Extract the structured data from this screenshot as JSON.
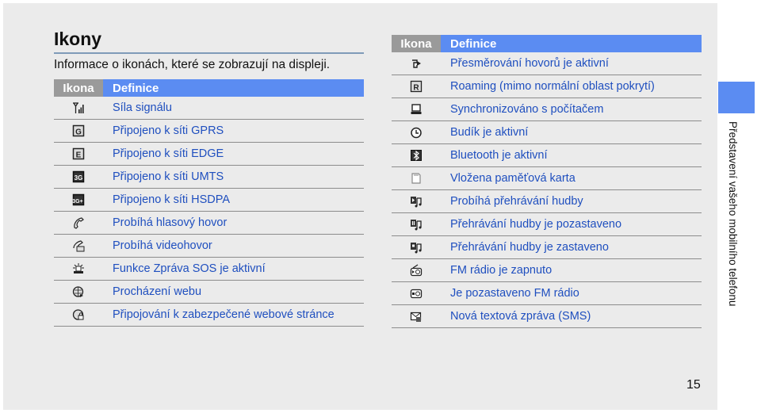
{
  "page": {
    "title": "Ikony",
    "intro": "Informace o ikonách, které se zobrazují na displeji.",
    "side_label": "Představení vašeho mobilního telefonu",
    "page_number": "15"
  },
  "colors": {
    "header_icon_bg": "#9a9a9a",
    "header_def_bg": "#5b8cf2",
    "definition_text": "#1f4fbf",
    "panel_bg": "#ebebeb"
  },
  "table_headers": {
    "icon": "Ikona",
    "definition": "Definice"
  },
  "left_table": [
    {
      "icon": "signal-strength-icon",
      "definition": "Síla signálu"
    },
    {
      "icon": "gprs-icon",
      "definition": "Připojeno k síti GPRS"
    },
    {
      "icon": "edge-icon",
      "definition": "Připojeno k síti EDGE"
    },
    {
      "icon": "umts-icon",
      "definition": "Připojeno k síti UMTS"
    },
    {
      "icon": "hsdpa-icon",
      "definition": "Připojeno k síti HSDPA"
    },
    {
      "icon": "voice-call-icon",
      "definition": "Probíhá hlasový hovor"
    },
    {
      "icon": "video-call-icon",
      "definition": "Probíhá videohovor"
    },
    {
      "icon": "sos-icon",
      "definition": "Funkce Zpráva SOS je aktivní"
    },
    {
      "icon": "web-browsing-icon",
      "definition": "Procházení webu"
    },
    {
      "icon": "secure-web-icon",
      "definition": "Připojování k zabezpečené webové stránce"
    }
  ],
  "right_table": [
    {
      "icon": "call-forwarding-icon",
      "definition": "Přesměrování hovorů je aktivní"
    },
    {
      "icon": "roaming-icon",
      "definition": "Roaming (mimo normální oblast pokrytí)"
    },
    {
      "icon": "pc-sync-icon",
      "definition": "Synchronizováno s počítačem"
    },
    {
      "icon": "alarm-icon",
      "definition": "Budík je aktivní"
    },
    {
      "icon": "bluetooth-icon",
      "definition": "Bluetooth je aktivní"
    },
    {
      "icon": "memory-card-icon",
      "definition": "Vložena paměťová karta"
    },
    {
      "icon": "music-playing-icon",
      "definition": "Probíhá přehrávání hudby"
    },
    {
      "icon": "music-paused-icon",
      "definition": "Přehrávání hudby je pozastaveno"
    },
    {
      "icon": "music-stopped-icon",
      "definition": "Přehrávání hudby je zastaveno"
    },
    {
      "icon": "fm-radio-on-icon",
      "definition": "FM rádio je zapnuto"
    },
    {
      "icon": "fm-radio-paused-icon",
      "definition": "Je pozastaveno FM rádio"
    },
    {
      "icon": "new-sms-icon",
      "definition": "Nová textová zpráva (SMS)"
    }
  ]
}
